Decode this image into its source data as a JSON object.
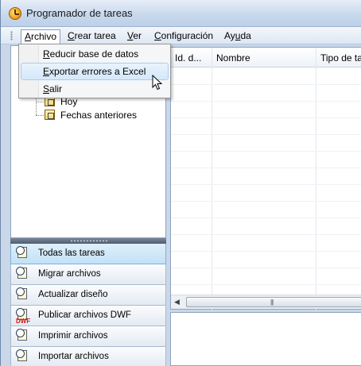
{
  "window": {
    "title": "Programador de tareas"
  },
  "menubar": {
    "items": [
      {
        "pre": "",
        "u": "A",
        "post": "rchivo"
      },
      {
        "pre": "",
        "u": "C",
        "post": "rear tarea"
      },
      {
        "pre": "",
        "u": "V",
        "post": "er"
      },
      {
        "pre": "",
        "u": "C",
        "post": "onfiguración"
      },
      {
        "pre": "Ay",
        "u": "u",
        "post": "da"
      }
    ]
  },
  "archivo_menu": {
    "items": [
      {
        "pre": "",
        "u": "R",
        "post": "educir base de datos"
      },
      {
        "pre": "",
        "u": "E",
        "post": "xportar errores a Excel"
      },
      {
        "pre": "",
        "u": "S",
        "post": "alir"
      }
    ],
    "hovered_index": 1
  },
  "tree": {
    "items": [
      {
        "label": "Hoy"
      },
      {
        "label": "Fechas anteriores"
      }
    ]
  },
  "nav": {
    "buttons": [
      {
        "label": "Todas las tareas",
        "selected": true,
        "icon": "clock-sheet-icon"
      },
      {
        "label": "Migrar archivos",
        "selected": false,
        "icon": "migrate-icon"
      },
      {
        "label": "Actualizar diseño",
        "selected": false,
        "icon": "update-icon"
      },
      {
        "label": "Publicar archivos DWF",
        "selected": false,
        "icon": "dwf-publish-icon",
        "tag": "DWF"
      },
      {
        "label": "Imprimir archivos",
        "selected": false,
        "icon": "print-icon"
      },
      {
        "label": "Importar archivos",
        "selected": false,
        "icon": "import-icon"
      }
    ]
  },
  "grid": {
    "columns": [
      {
        "label": "Id. d..."
      },
      {
        "label": "Nombre"
      },
      {
        "label": "Tipo de ta"
      }
    ]
  },
  "colors": {
    "menu_hover": "#d5e8fa",
    "nav_selected": "#c3e1f6",
    "title_bar": "#c7d8ec"
  }
}
